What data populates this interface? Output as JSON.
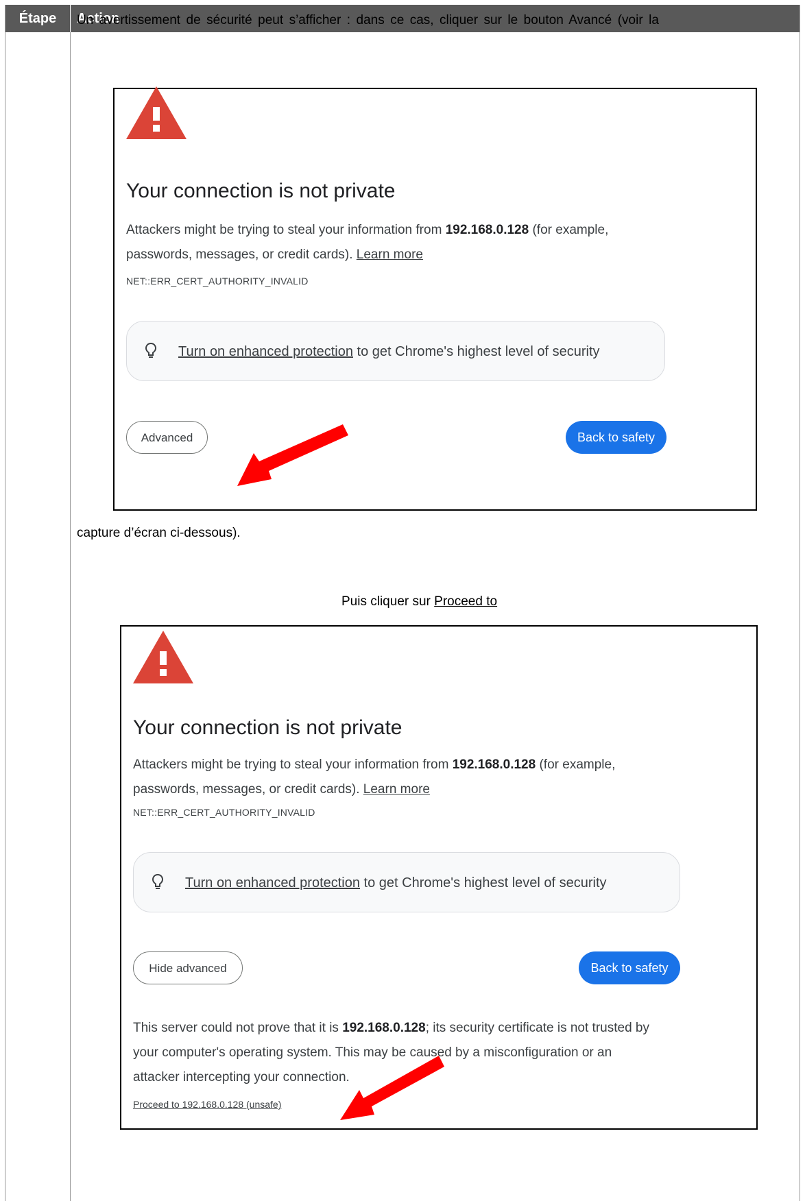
{
  "table": {
    "col_step": "Étape",
    "col_action": "Action"
  },
  "instructions": {
    "intro": "Un avertissement de sécurité peut s’afficher : dans ce cas, cliquer sur le bouton Avancé (voir la",
    "intro_end": "capture d’écran ci-dessous).",
    "then_prefix": "Puis cliquer sur ",
    "then_link": "Proceed to"
  },
  "warning1": {
    "title": "Your connection is not private",
    "body_pre": "Attackers might be trying to steal your information from ",
    "host": "192.168.0.128",
    "body_post": " (for example,",
    "body_line2": "passwords, messages, or credit cards). ",
    "learn_more": "Learn more",
    "error_code": "NET::ERR_CERT_AUTHORITY_INVALID",
    "enhanced_link": "Turn on enhanced protection",
    "enhanced_rest": " to get Chrome's highest level of security",
    "advanced_button": "Advanced",
    "back_button": "Back to safety"
  },
  "warning2": {
    "title": "Your connection is not private",
    "body_pre": "Attackers might be trying to steal your information from ",
    "host": "192.168.0.128",
    "body_post": " (for example,",
    "body_line2": "passwords, messages, or credit cards). ",
    "learn_more": "Learn more",
    "error_code": "NET::ERR_CERT_AUTHORITY_INVALID",
    "enhanced_link": "Turn on enhanced protection",
    "enhanced_rest": " to get Chrome's highest level of security",
    "hide_button": "Hide advanced",
    "back_button": "Back to safety",
    "detail_pre": "This server could not prove that it is ",
    "detail_host": "192.168.0.128",
    "detail_post": "; its security certificate is not trusted by",
    "detail_line2": "your computer's operating system. This may be caused by a misconfiguration or an",
    "detail_line3": "attacker intercepting your connection.",
    "proceed_link": "Proceed to 192.168.0.128 (unsafe)"
  },
  "colors": {
    "header_bg": "#595959",
    "warning_red": "#db4437",
    "primary_blue": "#1a73e8",
    "arrow_red": "#ff0000"
  },
  "icons": [
    "warning-triangle-icon",
    "lightbulb-icon",
    "red-arrow-icon"
  ]
}
